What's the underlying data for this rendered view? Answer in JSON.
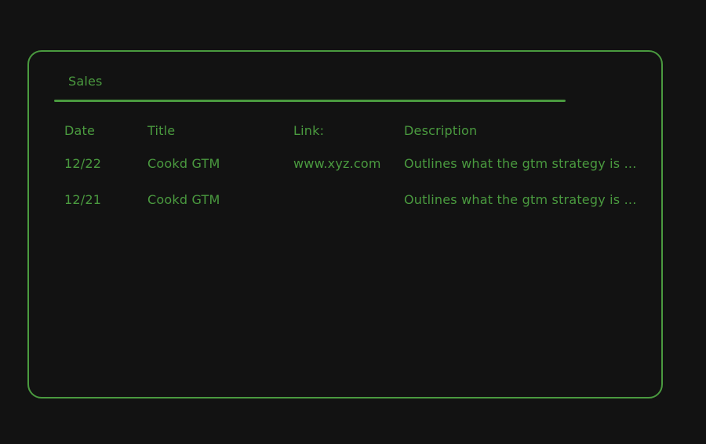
{
  "panel": {
    "tab_label": "Sales"
  },
  "table": {
    "headers": {
      "date": "Date",
      "title": "Title",
      "link": "Link:",
      "description": "Description"
    },
    "rows": [
      {
        "date": "12/22",
        "title": "Cookd GTM",
        "link": "www.xyz.com",
        "description": "Outlines what the gtm strategy is ..."
      },
      {
        "date": "12/21",
        "title": "Cookd GTM",
        "link": "",
        "description": "Outlines what the gtm strategy is ..."
      }
    ]
  },
  "colors": {
    "background": "#121212",
    "accent": "#4a9a3f"
  }
}
